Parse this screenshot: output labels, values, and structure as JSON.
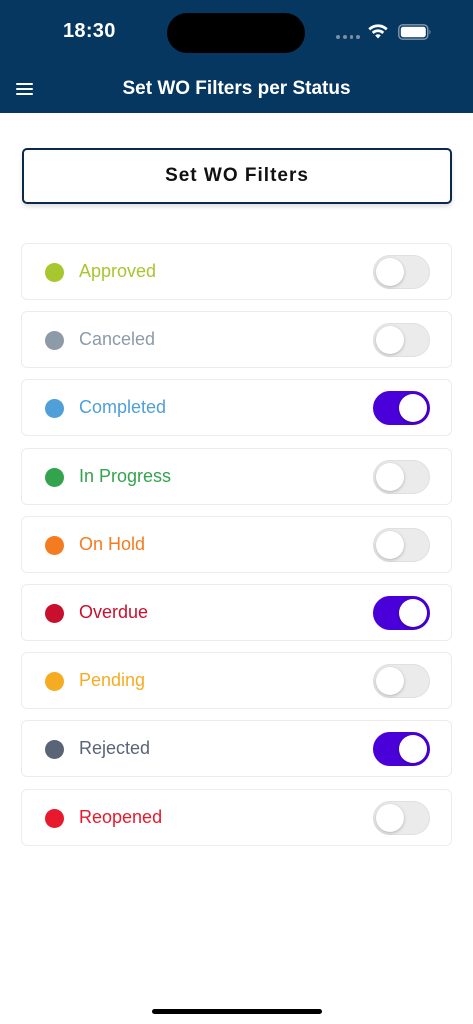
{
  "status_bar": {
    "time": "18:30",
    "icons": [
      "signal-icon",
      "wifi-icon",
      "battery-icon"
    ]
  },
  "header": {
    "title": "Set WO Filters per Status",
    "menu_icon": "hamburger-menu-icon",
    "background": "#063761"
  },
  "set_filters_button": {
    "label": "Set WO Filters"
  },
  "toggle_on_color": "#4a00d9",
  "statuses": [
    {
      "label": "Approved",
      "color": "#a8c62e",
      "enabled": false
    },
    {
      "label": "Canceled",
      "color": "#8d9aa8",
      "enabled": false
    },
    {
      "label": "Completed",
      "color": "#4f9fd9",
      "enabled": true
    },
    {
      "label": "In Progress",
      "color": "#33a34d",
      "enabled": false
    },
    {
      "label": "On Hold",
      "color": "#f47b20",
      "enabled": false
    },
    {
      "label": "Overdue",
      "color": "#c8102e",
      "enabled": true
    },
    {
      "label": "Pending",
      "color": "#f5ac22",
      "enabled": false
    },
    {
      "label": "Rejected",
      "color": "#5a6477",
      "enabled": true
    },
    {
      "label": "Reopened",
      "color": "#e8192c",
      "enabled": false
    }
  ]
}
